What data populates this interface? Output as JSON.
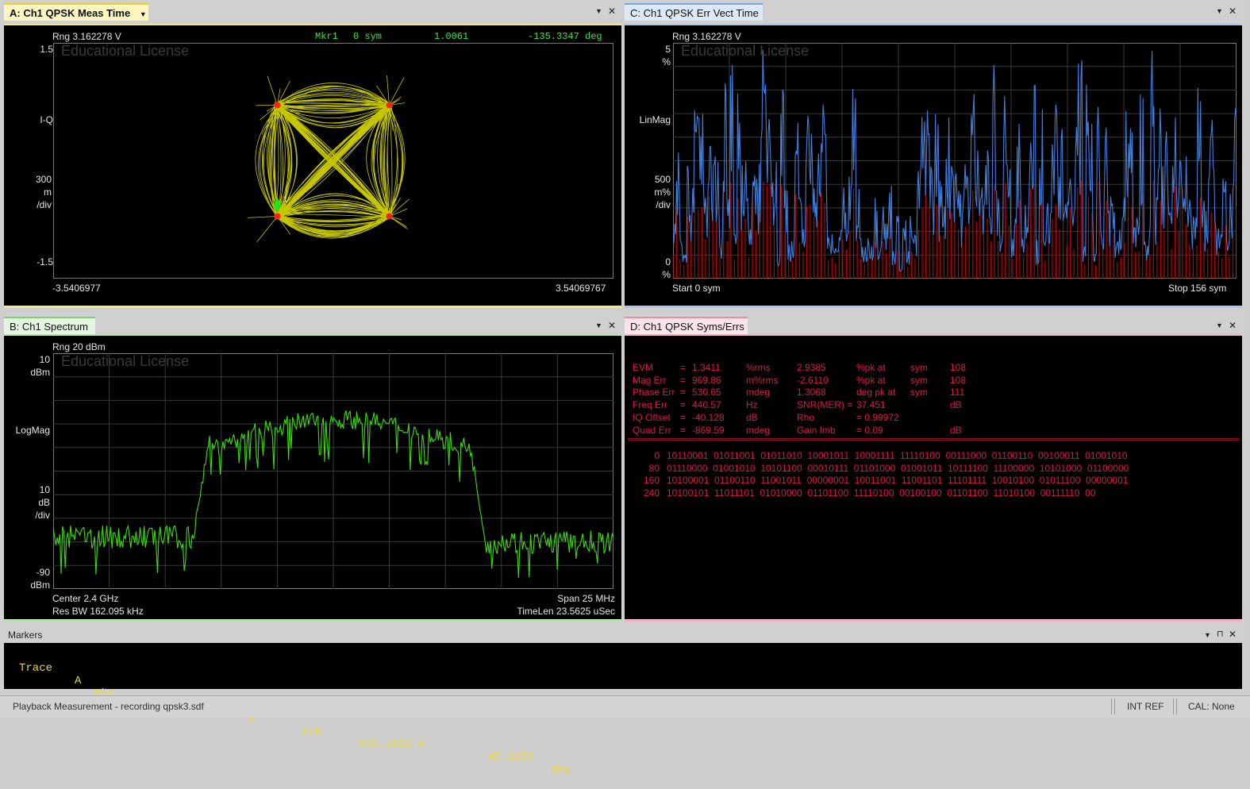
{
  "panes": {
    "A": {
      "tab": "A: Ch1 QPSK Meas Time",
      "range": "Rng 3.162278  V",
      "marker_label": "Mkr1",
      "marker_val1": "0  sym",
      "marker_val2": "1.0061",
      "marker_val3": "-135.3347  deg",
      "watermark": "Educational License",
      "y_top": "1.5",
      "y_mid": "I-Q",
      "y_scale1": "300",
      "y_scale2": "m",
      "y_scale3": "/div",
      "y_bottom": "-1.5",
      "x_left": "-3.5406977",
      "x_right": "3.54069767",
      "marker_number": "1"
    },
    "C": {
      "tab": "C: Ch1 QPSK Err Vect Time",
      "range": "Rng 3.162278  V",
      "watermark": "Educational License",
      "y_top1": "5",
      "y_top2": "%",
      "y_mid": "LinMag",
      "y_scale1": "500",
      "y_scale2": "m%",
      "y_scale3": "/div",
      "y_bottom1": "0",
      "y_bottom2": "%",
      "x_left": "Start 0  sym",
      "x_right": "Stop 156  sym"
    },
    "B": {
      "tab": "B: Ch1 Spectrum",
      "range": "Rng 20 dBm",
      "watermark": "Educational License",
      "y_top1": "10",
      "y_top2": "dBm",
      "y_mid": "LogMag",
      "y_scale1": "10",
      "y_scale2": "dB",
      "y_scale3": "/div",
      "y_bottom1": "-90",
      "y_bottom2": "dBm",
      "center": "Center 2.4 GHz",
      "span": "Span 25 MHz",
      "resbw": "Res BW 162.095 kHz",
      "timelen": "TimeLen 23.5625 uSec"
    },
    "D": {
      "tab": "D: Ch1 QPSK Syms/Errs",
      "metrics": [
        [
          "EVM",
          "=",
          "1.3411",
          "%rms",
          "2.9385",
          "%pk  at",
          "sym",
          "108"
        ],
        [
          "Mag Err",
          "=",
          "969.86",
          "m%rms",
          "-2.6110",
          "%pk  at",
          "sym",
          "108"
        ],
        [
          "Phase Err",
          "=",
          "530.65",
          "mdeg",
          "1.3068",
          "deg  pk  at",
          "sym",
          "111"
        ],
        [
          "Freq Err",
          "=",
          "440.57",
          "Hz",
          "SNR(MER) =",
          "37.451",
          "",
          "dB"
        ],
        [
          "IQ Offset",
          "=",
          "-40.128",
          "dB",
          "Rho",
          "= 0.99972",
          "",
          ""
        ],
        [
          "Quad Err",
          "=",
          "-869.59",
          "mdeg",
          "Gain  Imb",
          "= 0.09",
          "",
          "dB"
        ]
      ],
      "bits": [
        [
          "0",
          "10110001  01011001  01011010  10001011  10001111  11110100  00111000  01100110  00100011  01001010"
        ],
        [
          "80",
          "01110000  01001010  10101100  00010111  01101000  01001011  10111100  11100000  10101000  01100000"
        ],
        [
          "160",
          "10100001  01100110  11001011  00000001  10011001  11001101  11101111  10010100  01011100  00000001"
        ],
        [
          "240",
          "10100101  11011101  01010000  01101100  11110100  00100100  01101100  11010100  00111110  00"
        ]
      ]
    },
    "markers": {
      "title": "Markers",
      "trace": "Trace",
      "trace_id": "A",
      "mkr": "Mkr",
      "mkr_num": "1:",
      "x_val": "0",
      "x_unit": "sym",
      "y_val": "996.1882 m",
      "phase_val": "-45.2159",
      "phase_unit": "deg"
    }
  },
  "status": {
    "left": "Playback Measurement - recording qpsk3.sdf",
    "intref": "INT REF",
    "cal": "CAL: None"
  },
  "icons": {
    "dropdown": "▼",
    "close": "✕",
    "pin": "⊓"
  },
  "colors": {
    "paneA": "#f3e58f",
    "paneC": "#a9c8ec",
    "paneB": "#b6e3b0",
    "paneD": "#f2b2c5",
    "trace_yellow": "#e8e800",
    "trace_blue": "#3f7fe0",
    "trace_red": "#c00000",
    "trace_green": "#39e000",
    "text_red": "#e0144a"
  },
  "chart_data": [
    {
      "type": "scatter",
      "title": "A: Ch1 QPSK Meas Time",
      "xlim": [
        -3.5406977,
        3.54069767
      ],
      "ylim": [
        -1.5,
        1.5
      ],
      "ylabel": "I-Q",
      "points": [
        [
          -0.707,
          0.707
        ],
        [
          0.707,
          0.707
        ],
        [
          -0.707,
          -0.707
        ],
        [
          0.707,
          -0.707
        ]
      ],
      "marker": {
        "x": -0.707,
        "y": -0.707,
        "label": "1"
      }
    },
    {
      "type": "bar",
      "title": "C: Ch1 QPSK Err Vect Time",
      "ylabel": "LinMag",
      "xlim": [
        0,
        156
      ],
      "ylim": [
        0,
        5
      ],
      "series": [
        {
          "values": "approx. error-vector magnitude, % per symbol (0–5%)"
        }
      ]
    },
    {
      "type": "line",
      "title": "B: Ch1 Spectrum",
      "ylabel": "LogMag",
      "ylim": [
        -90,
        10
      ],
      "xlabel": "Center 2.4 GHz / Span 25 MHz",
      "series": [
        {
          "values": "spectrum magnitude (dBm), approx plateau -18 to -10 dBm over occupied band, noise floor -60 to -75 dBm"
        }
      ]
    }
  ]
}
